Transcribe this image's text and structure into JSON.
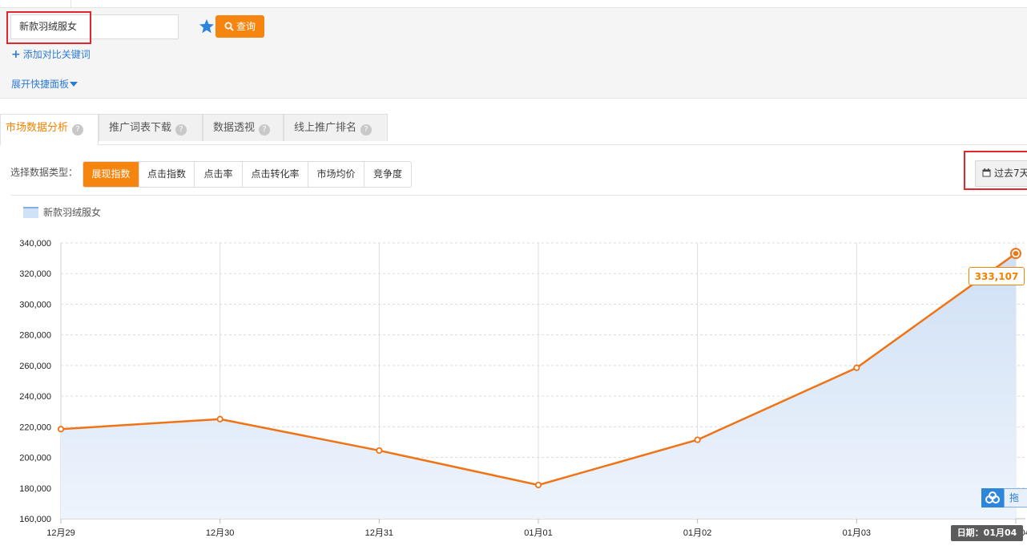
{
  "search": {
    "keyword": "新款羽绒服女",
    "query_label": "查询",
    "add_compare_label": "添加对比关键词",
    "expand_panel_label": "展开快捷面板"
  },
  "tabs": [
    {
      "label": "市场数据分析",
      "active": true
    },
    {
      "label": "推广词表下载",
      "active": false
    },
    {
      "label": "数据透视",
      "active": false
    },
    {
      "label": "线上推广排名",
      "active": false
    }
  ],
  "data_type": {
    "label": "选择数据类型：",
    "options": [
      "展现指数",
      "点击指数",
      "点击率",
      "点击转化率",
      "市场均价",
      "竞争度"
    ],
    "selected": "展现指数"
  },
  "date_range_label": "过去7天",
  "float_button_label": "拖",
  "tooltip": {
    "value": "333,107",
    "date_label": "日期：01月04"
  },
  "colors": {
    "accent": "#f5850f",
    "line": "#f07416",
    "area": "#dbe8f8",
    "link": "#2d7bd4",
    "highlight_box": "#e3262d"
  },
  "chart_data": {
    "type": "area",
    "x": [
      "12月29",
      "12月30",
      "12月31",
      "01月01",
      "01月02",
      "01月03",
      "01月04"
    ],
    "series": [
      {
        "name": "新款羽绒服女",
        "values": [
          218500,
          225000,
          204500,
          182000,
          211500,
          258500,
          333107
        ]
      }
    ],
    "y_ticks": [
      160000,
      180000,
      200000,
      220000,
      240000,
      260000,
      280000,
      300000,
      320000,
      340000
    ],
    "y_tick_labels": [
      "160,000",
      "180,000",
      "200,000",
      "220,000",
      "240,000",
      "260,000",
      "280,000",
      "300,000",
      "320,000",
      "340,000"
    ],
    "ylim": [
      160000,
      340000
    ],
    "highlighted_index": 6,
    "grid": true,
    "legend": "top-left"
  }
}
